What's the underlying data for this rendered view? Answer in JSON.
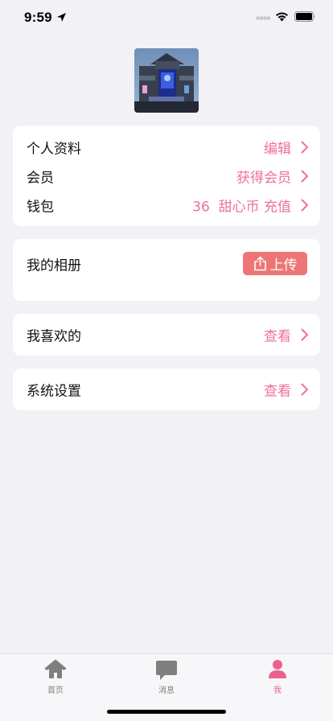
{
  "status_bar": {
    "time": "9:59"
  },
  "profile": {
    "rows": [
      {
        "label": "个人资料",
        "value": "编辑"
      },
      {
        "label": "会员",
        "value": "获得会员"
      },
      {
        "label": "钱包",
        "value": "36  甜心币 充值"
      }
    ]
  },
  "album": {
    "title": "我的相册",
    "upload_label": "上传"
  },
  "favorites": {
    "label": "我喜欢的",
    "value": "查看"
  },
  "settings": {
    "label": "系统设置",
    "value": "查看"
  },
  "colors": {
    "accent": "#ef6f9a",
    "upload_bg": "#ee7576",
    "tab_active": "#ef5f90"
  },
  "tabs": [
    {
      "label": "首页",
      "icon": "home-icon",
      "active": false
    },
    {
      "label": "消息",
      "icon": "message-icon",
      "active": false
    },
    {
      "label": "我",
      "icon": "person-icon",
      "active": true
    }
  ]
}
